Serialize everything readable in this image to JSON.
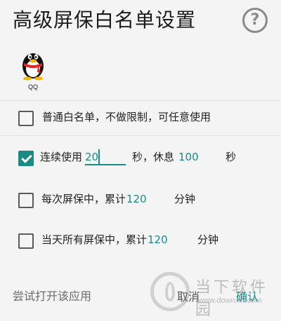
{
  "header": {
    "title": "高级屏保白名单设置",
    "help_icon": "help-circle-icon",
    "help_glyph": "?"
  },
  "app": {
    "label": "QQ",
    "icon": "qq-penguin-icon"
  },
  "options": [
    {
      "checked": false,
      "label": "普通白名单，不做限制，可任意使用"
    },
    {
      "checked": true,
      "prefix": "连续使用",
      "input_value": "20",
      "middle": "秒，休息",
      "rest_value": "100",
      "suffix": "秒"
    },
    {
      "checked": false,
      "prefix": "每次屏保中，累计",
      "value": "120",
      "suffix": "分钟"
    },
    {
      "checked": false,
      "prefix": "当天所有屏保中，累计",
      "value": "120",
      "suffix": "分钟"
    }
  ],
  "bottom": {
    "try_open": "尝试打开该应用",
    "cancel": "取消",
    "confirm": "确认"
  },
  "watermark": {
    "text": "当下软件园",
    "url": "www.downxia.com"
  },
  "colors": {
    "accent": "#1a8a86",
    "background": "#f4f4f4"
  }
}
